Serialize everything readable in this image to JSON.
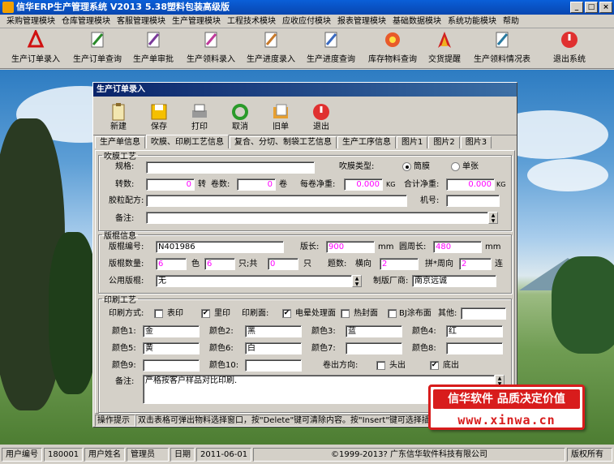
{
  "title": "信华ERP生产管理系统   V2013   5.38塑料包装高级版",
  "window_buttons": [
    "_",
    "□",
    "×"
  ],
  "menu": [
    "采购管理模块",
    "仓库管理模块",
    "客服管理模块",
    "生产管理模块",
    "工程技术模块",
    "应收应付模块",
    "报表管理模块",
    "基础数据模块",
    "系统功能模块",
    "帮助"
  ],
  "toolbar": [
    "生产订单录入",
    "生产订单查询",
    "生产单审批",
    "生产领料录入",
    "生产进度录入",
    "生产进度查询",
    "库存物料查询",
    "交货提醒",
    "生产领料情况表",
    "退出系统"
  ],
  "order_window": {
    "title": "生产订单录入",
    "tools": [
      "新建",
      "保存",
      "打印",
      "取消",
      "旧单",
      "退出"
    ],
    "tabs": [
      "生产单信息",
      "吹膜、印刷工艺信息",
      "复合、分切、制袋工艺信息",
      "生产工序信息",
      "图片1",
      "图片2",
      "图片3"
    ],
    "film": {
      "legend": "吹膜工艺",
      "spec_label": "规格:",
      "spec": "",
      "type_label": "吹膜类型:",
      "type_opts": [
        "筒膜",
        "单张"
      ],
      "turns_label": "转数:",
      "turns": "0",
      "turns_unit": "转",
      "rolls_label": "卷数:",
      "rolls": "0",
      "rolls_unit": "卷",
      "net_label": "每卷净重:",
      "net": "0.000",
      "net_unit": "KG",
      "total_label": "合计净重:",
      "total": "0.000",
      "total_unit": "KG",
      "formula_label": "胶粒配方:",
      "formula": "",
      "machine_label": "机号:",
      "machine": "",
      "note_label": "备注:",
      "note": ""
    },
    "plate": {
      "legend": "版棍信息",
      "code_label": "版棍编号:",
      "code": "N401986",
      "len_label": "版长:",
      "len": "900",
      "len_unit": "mm",
      "circ_label": "圆周长:",
      "circ": "480",
      "circ_unit": "mm",
      "qty_label": "版棍数量:",
      "qty": "6",
      "colors_unit": "色",
      "colors": "6",
      "total_unit": "只;共",
      "total": "0",
      "pcs_unit": "只",
      "count_label": "题数:",
      "horiz_label": "横向",
      "horiz": "2",
      "vert_label": "拼*周向",
      "vert": "2",
      "link_unit": "连",
      "common_label": "公用版棍:",
      "common": "无",
      "maker_label": "制版厂商:",
      "maker": "南京远诚"
    },
    "print": {
      "legend": "印刷工艺",
      "method_label": "印刷方式:",
      "surface": "表印",
      "inner": "里印",
      "face_label": "印刷面:",
      "corona": "电晕处理面",
      "heat": "热封面",
      "coat": "BJ涂布面",
      "other_label": "其他:",
      "colors": [
        {
          "label": "颜色1:",
          "value": "金"
        },
        {
          "label": "颜色2:",
          "value": "黑"
        },
        {
          "label": "颜色3:",
          "value": "蓝"
        },
        {
          "label": "颜色4:",
          "value": "红"
        },
        {
          "label": "颜色5:",
          "value": "黄"
        },
        {
          "label": "颜色6:",
          "value": "白"
        },
        {
          "label": "颜色7:",
          "value": ""
        },
        {
          "label": "颜色8:",
          "value": ""
        },
        {
          "label": "颜色9:",
          "value": ""
        },
        {
          "label": "颜色10:",
          "value": ""
        }
      ],
      "roll_dir_label": "卷出方向:",
      "head": "头出",
      "tail": "底出",
      "note_label": "备注:",
      "note": "严格按客户样品对比印刷."
    },
    "hint_label": "操作提示",
    "hint": "双击表格可弹出物料选择窗口，按\"Delete\"键可清除内容。按\"Insert\"键可选择插入"
  },
  "status": [
    {
      "k": "用户编号",
      "v": "180001"
    },
    {
      "k": "用户姓名",
      "v": "管理员"
    },
    {
      "k": "日期",
      "v": "2011-06-01"
    }
  ],
  "copyright": "©1999-2013?  广东信华软件科技有限公司",
  "rights": "版权所有",
  "promo": {
    "line1": "信华软件 品质决定价值",
    "line2": "www.xinwa.cn"
  }
}
